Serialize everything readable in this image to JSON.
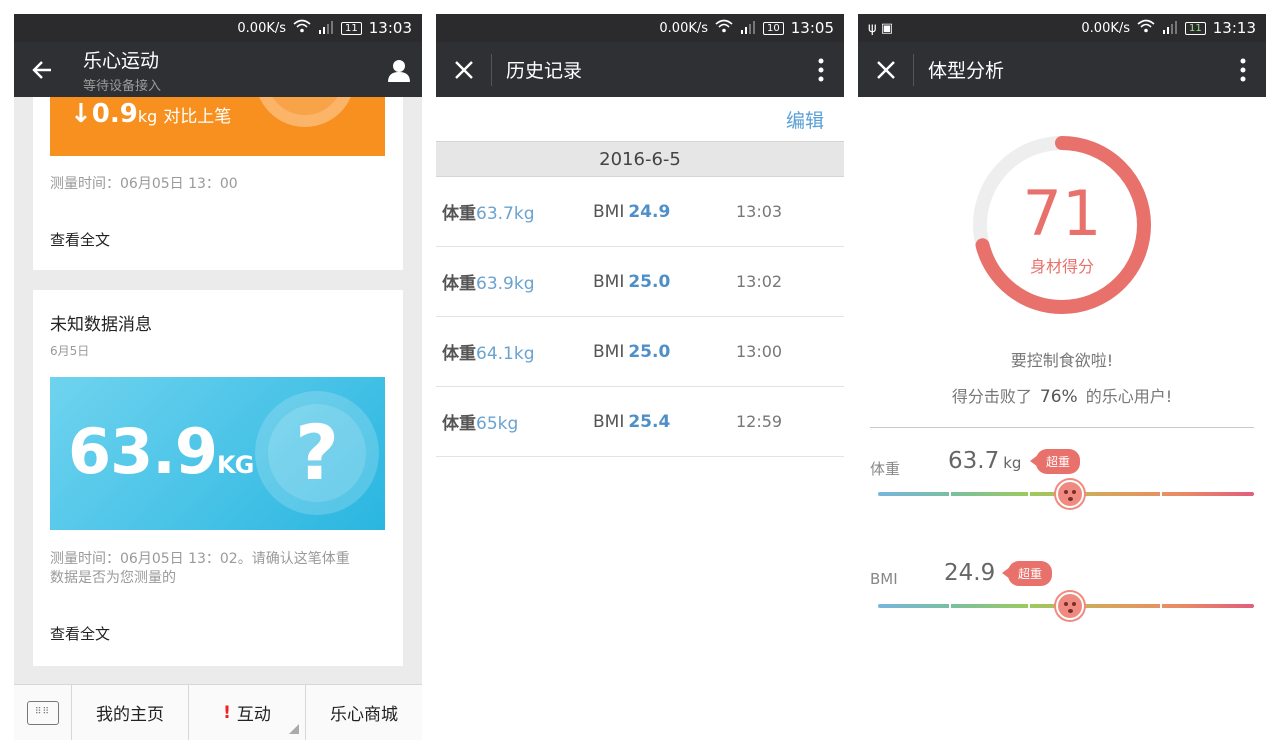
{
  "screen1": {
    "status": {
      "speed": "0.00K/s",
      "battery": "11",
      "time": "13:03"
    },
    "appbar": {
      "title": "乐心运动",
      "subtitle": "等待设备接入"
    },
    "card1": {
      "banner_value": "↓0.9",
      "banner_unit": "kg",
      "banner_compare": "对比上笔",
      "meta": "测量时间：06月05日 13：00",
      "readmore": "查看全文"
    },
    "card2": {
      "title": "未知数据消息",
      "date": "6月5日",
      "banner_value": "63.9",
      "banner_unit": "KG",
      "banner_symbol": "?",
      "meta_line1": "测量时间：06月05日 13：02。请确认这笔体重",
      "meta_line2": "数据是否为您测量的",
      "readmore": "查看全文"
    },
    "bottom_bar": {
      "keyboard": "⌨",
      "home": "我的主页",
      "interact": "互动",
      "interact_alert": "!",
      "mall": "乐心商城"
    }
  },
  "screen2": {
    "status": {
      "speed": "0.00K/s",
      "battery": "10",
      "time": "13:05"
    },
    "appbar": {
      "title": "历史记录"
    },
    "edit": "编辑",
    "date": "2016-6-5",
    "weight_label": "体重",
    "bmi_label": "BMI",
    "records": [
      {
        "weight": "63.7kg",
        "bmi": "24.9",
        "time": "13:03"
      },
      {
        "weight": "63.9kg",
        "bmi": "25.0",
        "time": "13:02"
      },
      {
        "weight": "64.1kg",
        "bmi": "25.0",
        "time": "13:00"
      },
      {
        "weight": "65kg",
        "bmi": "25.4",
        "time": "12:59"
      }
    ]
  },
  "screen3": {
    "status": {
      "speed": "0.00K/s",
      "battery": "11",
      "time": "13:13",
      "left_icons": "ψ ▣"
    },
    "appbar": {
      "title": "体型分析"
    },
    "score": "71",
    "score_fraction": 0.71,
    "score_label": "身材得分",
    "advice": "要控制食欲啦!",
    "beat_prefix": "得分击败了",
    "beat_pct": "76%",
    "beat_suffix": "的乐心用户!",
    "metrics": {
      "weight": {
        "label": "体重",
        "value": "63.7",
        "unit": "kg",
        "badge": "超重",
        "level": 0.51
      },
      "bmi": {
        "label": "BMI",
        "value": "24.9",
        "unit": "",
        "badge": "超重",
        "level": 0.51
      }
    },
    "colors": {
      "accent": "#e8716c",
      "ring_bg": "#eeeeee"
    }
  }
}
